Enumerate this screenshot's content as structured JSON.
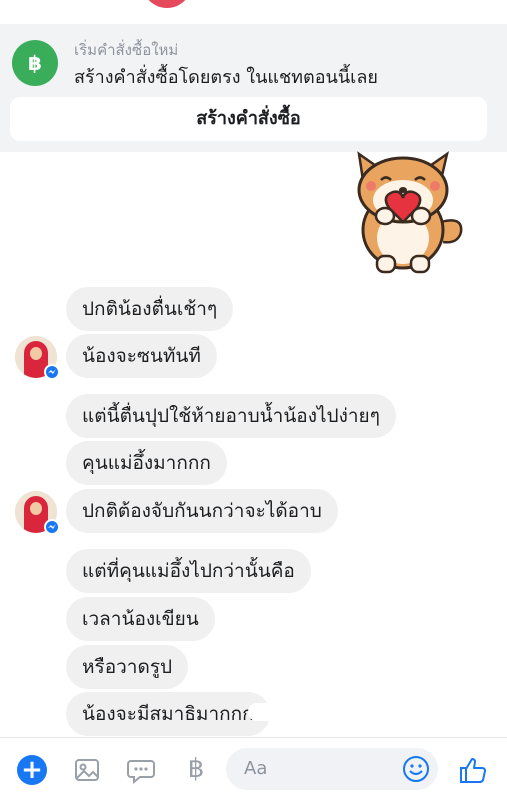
{
  "order_panel": {
    "icon_glyph": "฿",
    "subtitle": "เริ่มคำสั่งซื้อใหม่",
    "title": "สร้างคำสั่งซื้อโดยตรง ในแชทตอนนี้เลย",
    "button_label": "สร้างคำสั่งซื้อ"
  },
  "messages": [
    "ปกติน้องตื่นเช้าๆ",
    "น้องจะซนทันที",
    "แต่นี้ตื่นปุปใช้ห้ายอาบน้ำน้องไปง่ายๆ",
    "คุนแม่อึ้งมากกก",
    "ปกติต้องจับกันนกว่าจะได้อาบ",
    "แต่ที่คุนแม่อึ้งไปกว่านั้นคือ",
    "เวลาน้องเขียน",
    "หรือวาดรูป",
    "น้องจะมีสมาธิมากกก"
  ],
  "composer": {
    "placeholder": "Aa",
    "baht_glyph": "฿",
    "plus_glyph": "+"
  },
  "colors": {
    "accent": "#1877f2",
    "order_icon": "#3aad5a",
    "bubble": "#f0f0f0"
  }
}
